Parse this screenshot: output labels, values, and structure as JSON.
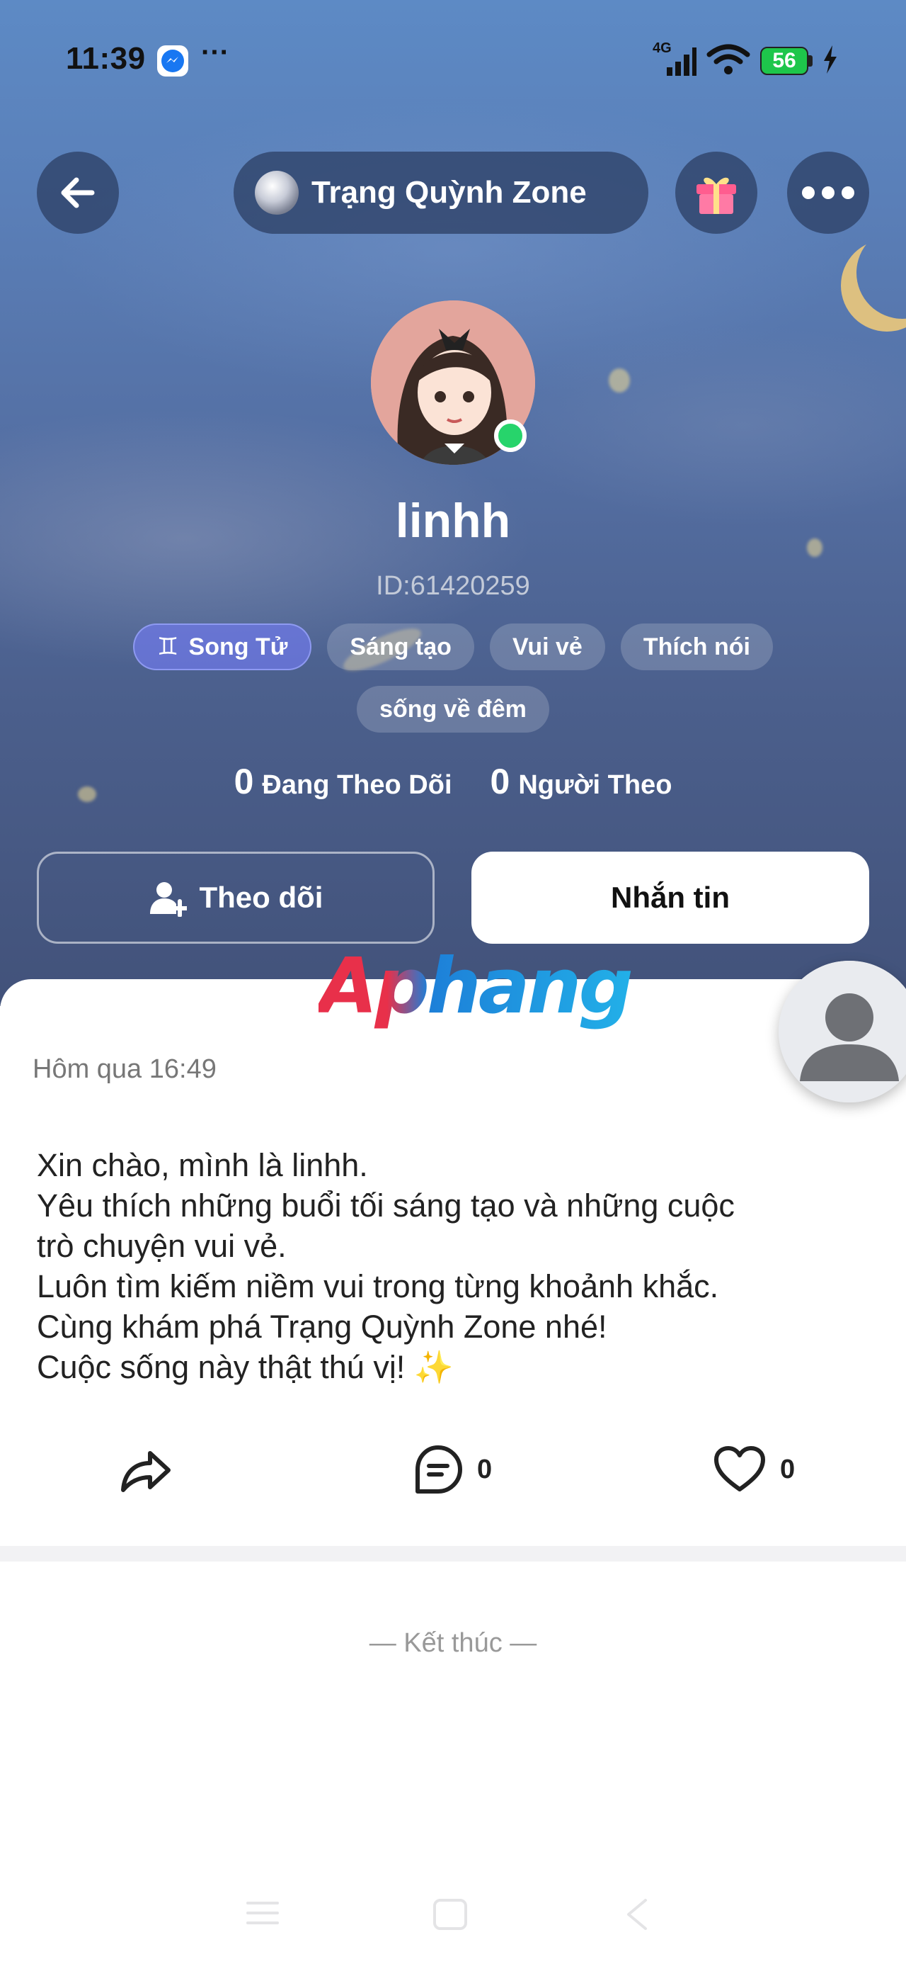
{
  "status_bar": {
    "time": "11:39",
    "more": "···",
    "network": "4G",
    "battery": "56"
  },
  "header": {
    "zone_name": "Trạng Quỳnh Zone"
  },
  "profile": {
    "username": "linhh",
    "user_id": "ID:61420259",
    "tags": [
      {
        "label": "Song Tử",
        "icon": "gemini-zodiac-icon"
      },
      {
        "label": "Sáng tạo"
      },
      {
        "label": "Vui vẻ"
      },
      {
        "label": "Thích nói"
      },
      {
        "label": "sống về đêm"
      }
    ],
    "following_count": "0",
    "following_label": "Đang Theo Dõi",
    "followers_count": "0",
    "followers_label": "Người Theo"
  },
  "buttons": {
    "follow": "Theo dõi",
    "message": "Nhắn tin"
  },
  "watermark": "Aphang",
  "post": {
    "time": "Hôm qua 16:49",
    "lines": [
      "Xin chào, mình là linhh.",
      "Yêu thích những buổi tối sáng tạo và những cuộc",
      "trò chuyện vui vẻ.",
      "Luôn tìm kiếm niềm vui trong từng khoảnh khắc.",
      "Cùng khám phá Trạng Quỳnh Zone nhé!",
      "Cuộc sống này thật thú vị! ✨"
    ],
    "comment_count": "0",
    "like_count": "0"
  },
  "end_text": "— Kết thúc —",
  "colors": {
    "online": "#27d46b",
    "battery": "#1ec64b",
    "zodiac_tag": "#6e78e6"
  }
}
